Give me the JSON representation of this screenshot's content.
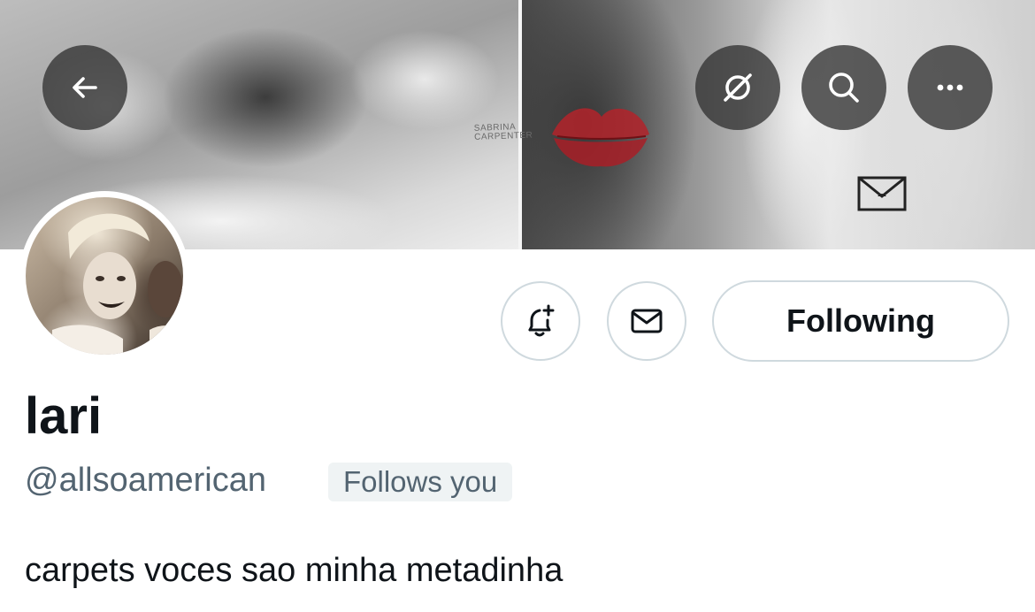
{
  "header": {
    "back_icon": "arrow-left-icon",
    "grok_icon": "slashed-circle-icon",
    "search_icon": "search-icon",
    "more_icon": "more-horizontal-icon",
    "banner_watermark": "SABRINA CARPENTER"
  },
  "profile": {
    "display_name": "lari",
    "handle": "@allsoamerican",
    "follows_you_label": "Follows you",
    "bio": "carpets voces sao minha metadinha"
  },
  "actions": {
    "notify_icon": "bell-plus-icon",
    "message_icon": "envelope-icon",
    "following_label": "Following"
  },
  "colors": {
    "primary_text": "#0f1419",
    "secondary_text": "#536471",
    "border": "#cfd9de",
    "badge_bg": "#eff3f4"
  }
}
